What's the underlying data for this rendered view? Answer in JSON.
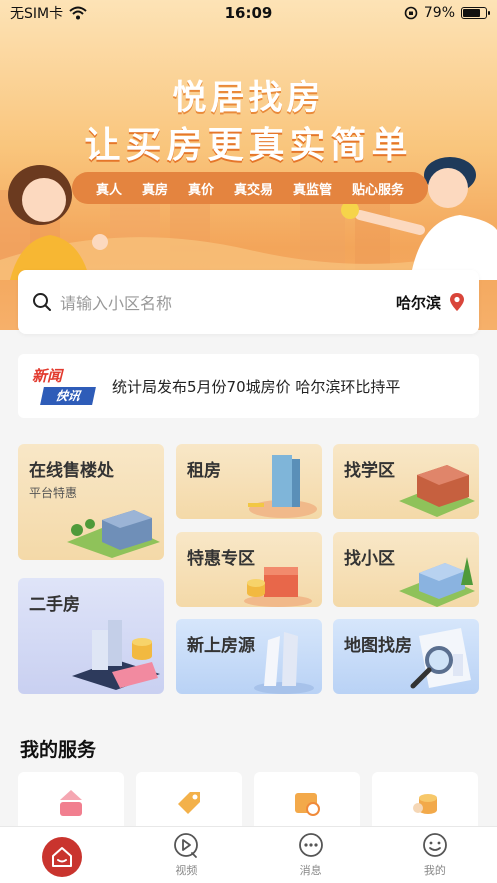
{
  "status_bar": {
    "carrier": "无SIM卡",
    "time": "16:09",
    "battery": "79%",
    "battery_level": 0.79
  },
  "banner": {
    "title_line1": "悦居找房",
    "title_line2": "让买房更真实简单",
    "tags": [
      "真人",
      "真房",
      "真价",
      "真交易",
      "真监管",
      "贴心服务"
    ]
  },
  "search": {
    "placeholder": "请输入小区名称",
    "city": "哈尔滨"
  },
  "news": {
    "logo_top": "新闻",
    "logo_bottom": "快讯",
    "headline": "统计局发布5月份70城房价  哈尔滨环比持平"
  },
  "grid": {
    "online_sales": {
      "label": "在线售楼处",
      "sub": "平台特惠"
    },
    "rent": {
      "label": "租房"
    },
    "school": {
      "label": "找学区"
    },
    "special": {
      "label": "特惠专区"
    },
    "community": {
      "label": "找小区"
    },
    "second_hand": {
      "label": "二手房"
    },
    "new_listing": {
      "label": "新上房源"
    },
    "map": {
      "label": "地图找房"
    }
  },
  "services": {
    "title": "我的服务"
  },
  "tabbar": {
    "video": "视频",
    "message": "消息",
    "me": "我的"
  },
  "colors": {
    "accent": "#c9342e",
    "banner_orange": "#f3a55a",
    "pill": "#e4843f"
  }
}
